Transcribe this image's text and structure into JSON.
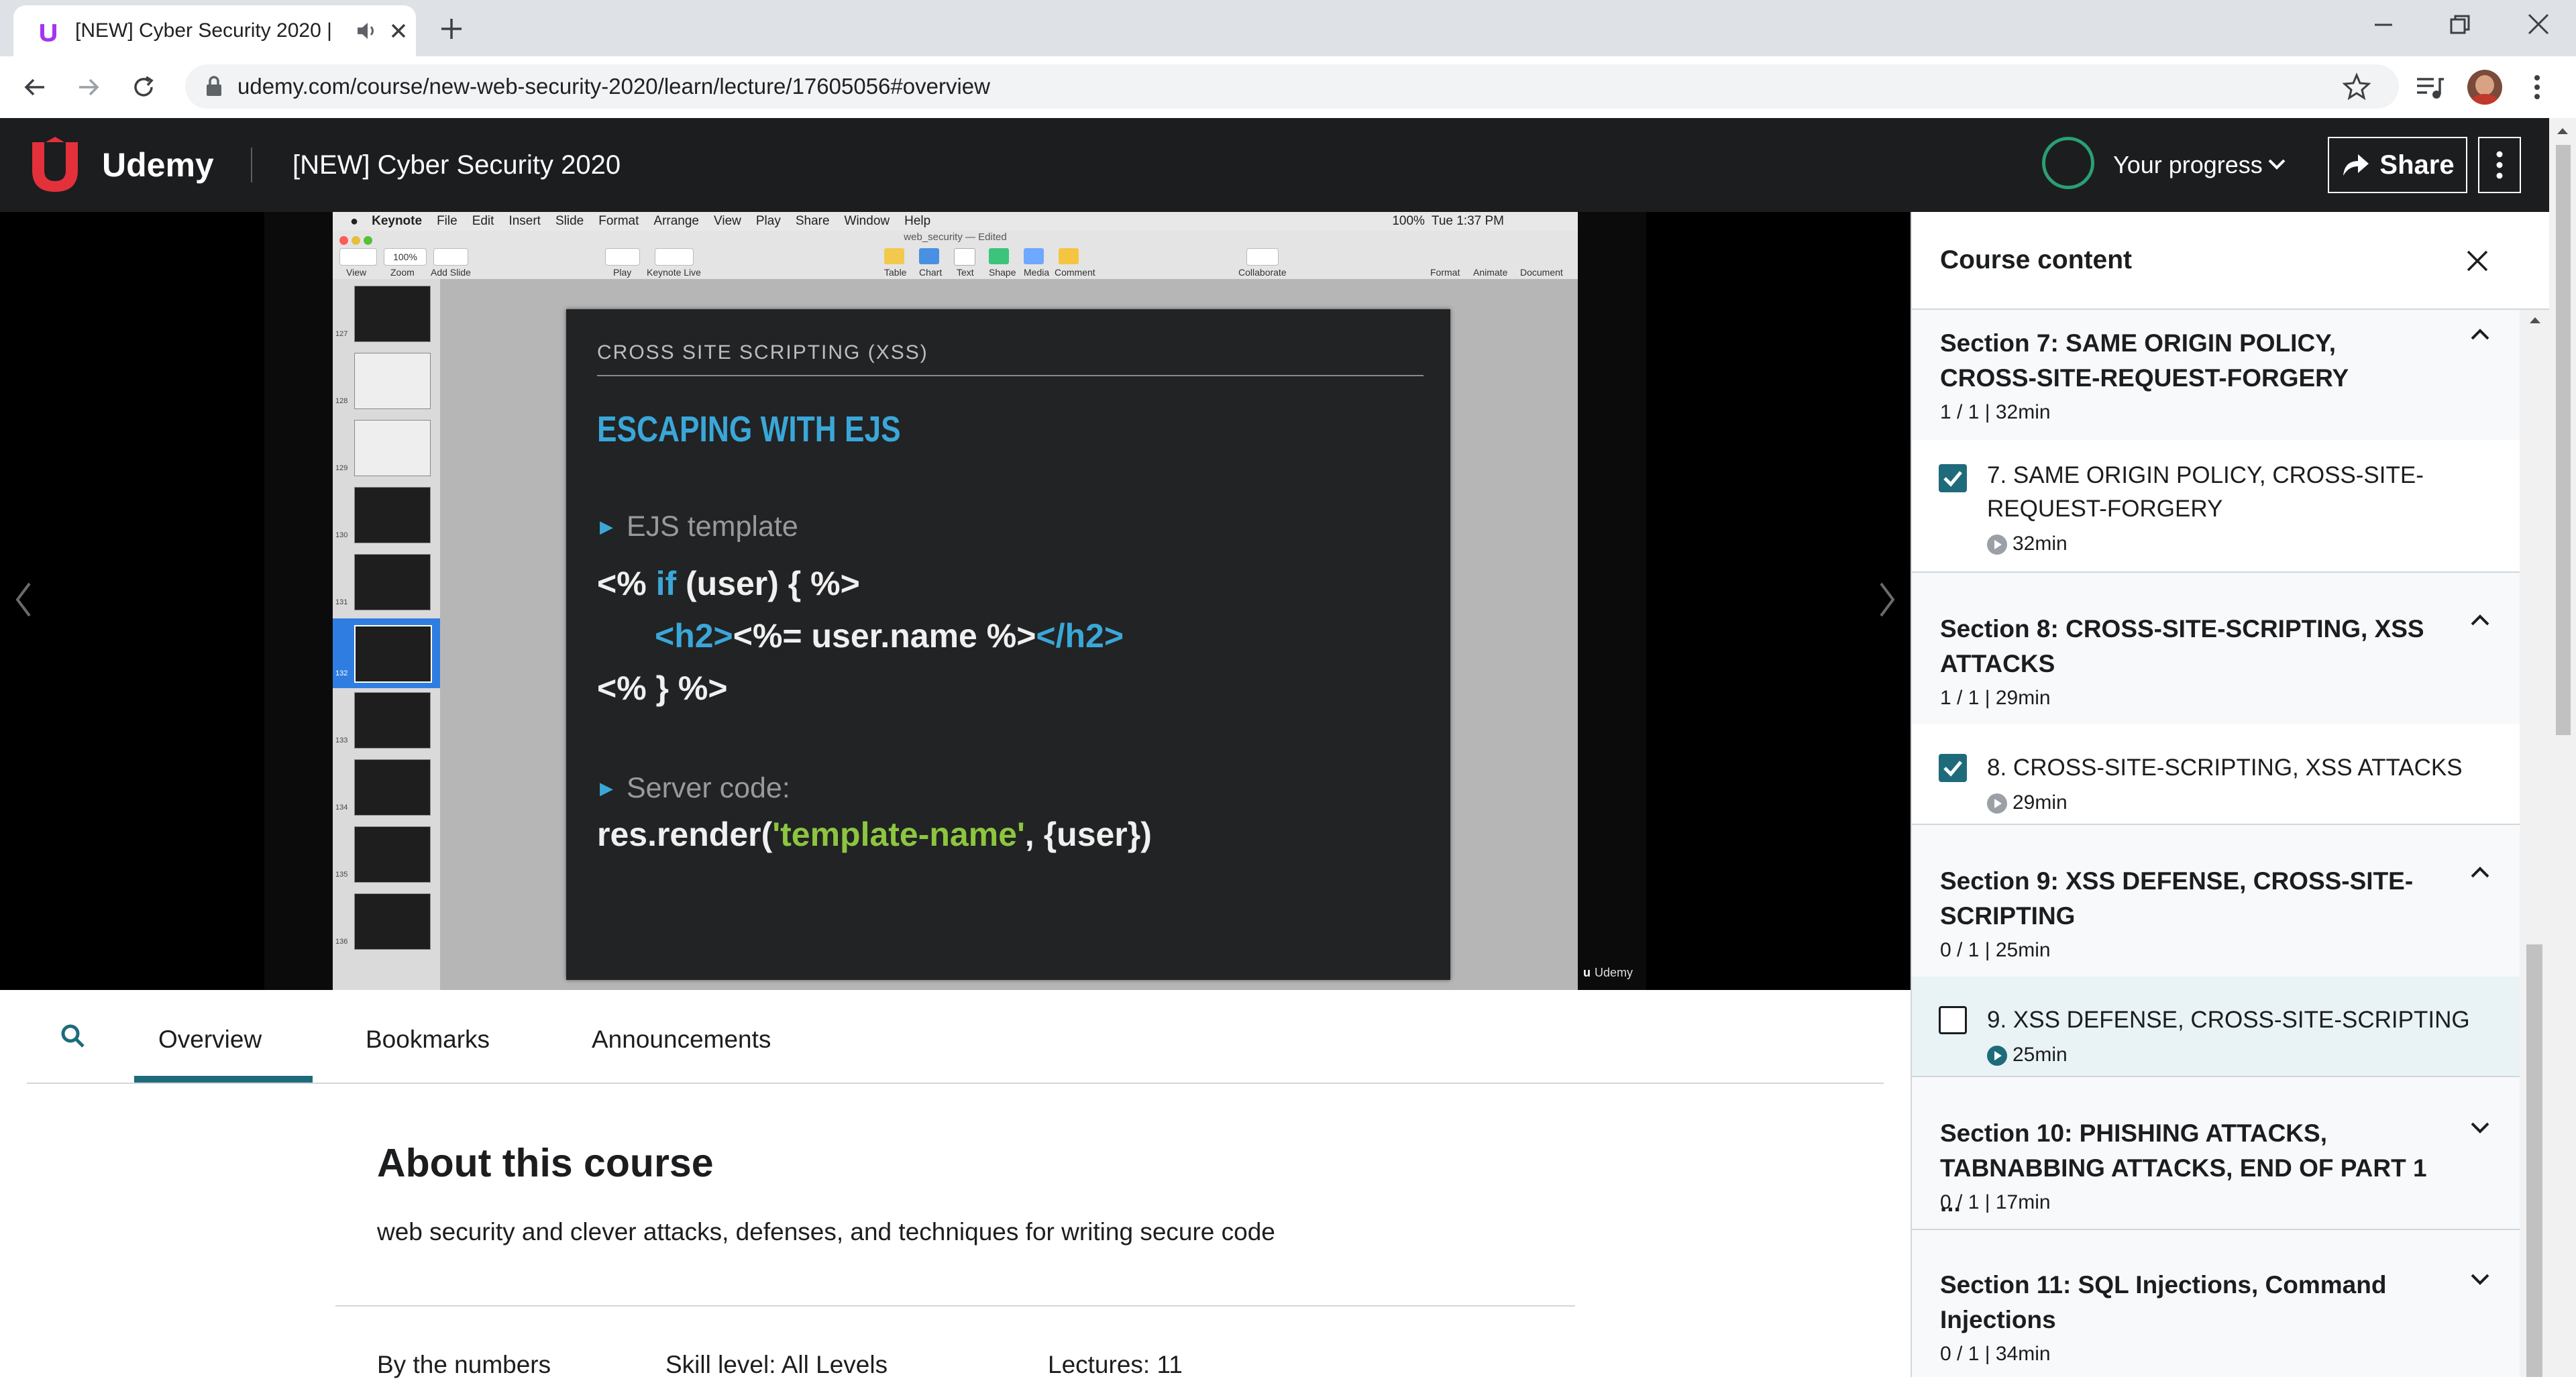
{
  "browser": {
    "tab_title": "[NEW] Cyber Security 2020 |",
    "url": "udemy.com/course/new-web-security-2020/learn/lecture/17605056#overview"
  },
  "header": {
    "brand": "Udemy",
    "course_title": "[NEW] Cyber Security 2020",
    "progress_label": "Your progress",
    "share_label": "Share"
  },
  "keynote": {
    "app_name": "Keynote",
    "menus": [
      "File",
      "Edit",
      "Insert",
      "Slide",
      "Format",
      "Arrange",
      "View",
      "Play",
      "Share",
      "Window",
      "Help"
    ],
    "status_battery": "100%",
    "status_time": "Tue 1:37 PM",
    "doc_title": "web_security — Edited",
    "zoom": "100%",
    "toolbar_left": [
      "View",
      "Zoom",
      "Add Slide"
    ],
    "toolbar_mid": [
      "Play",
      "Keynote Live"
    ],
    "toolbar_insert": [
      "Table",
      "Chart",
      "Text",
      "Shape",
      "Media",
      "Comment"
    ],
    "toolbar_collab": "Collaborate",
    "toolbar_right": [
      "Format",
      "Animate",
      "Document"
    ],
    "slide_numbers": [
      "127",
      "128",
      "129",
      "130",
      "131",
      "132",
      "133",
      "134",
      "135",
      "136"
    ],
    "watermark": "Udemy"
  },
  "slide": {
    "header": "CROSS SITE SCRIPTING (XSS)",
    "title": "ESCAPING WITH EJS",
    "bullet1": "EJS template",
    "code1_a": "<% ",
    "code1_kw": "if",
    "code1_b": " (user) { %>",
    "code2_tag1": "<h2>",
    "code2_mid": "<%= user.name %>",
    "code2_tag2": "</h2>",
    "code3": "<% } %>",
    "bullet2": "Server code:",
    "code4_a": "res.render(",
    "code4_str": "'template-name'",
    "code4_b": ", {user})"
  },
  "tabs": [
    "Overview",
    "Bookmarks",
    "Announcements"
  ],
  "overview": {
    "title": "About this course",
    "description": "web security and clever attacks, defenses, and techniques for writing secure code",
    "by_numbers": "By the numbers",
    "skill": "Skill level: All Levels",
    "lectures": "Lectures: 11"
  },
  "sidebar": {
    "title": "Course content",
    "sections": [
      {
        "title": "Section 7: SAME ORIGIN POLICY, CROSS-SITE-REQUEST-FORGERY",
        "meta": "1 / 1 | 32min",
        "lecture": {
          "title": "7. SAME ORIGIN POLICY, CROSS-SITE-REQUEST-FORGERY",
          "duration": "32min",
          "done": true
        }
      },
      {
        "title": "Section 8: CROSS-SITE-SCRIPTING, XSS ATTACKS",
        "meta": "1 / 1 | 29min",
        "lecture": {
          "title": "8. CROSS-SITE-SCRIPTING, XSS ATTACKS",
          "duration": "29min",
          "done": true
        }
      },
      {
        "title": "Section 9: XSS DEFENSE, CROSS-SITE-SCRIPTING",
        "meta": "0 / 1 | 25min",
        "lecture": {
          "title": "9. XSS DEFENSE, CROSS-SITE-SCRIPTING",
          "duration": "25min",
          "done": false
        }
      },
      {
        "title": "Section 10: PHISHING ATTACKS, TABNABBING ATTACKS, END OF PART 1 ...",
        "meta": "0 / 1 | 17min"
      },
      {
        "title": "Section 11: SQL Injections, Command Injections",
        "meta": "0 / 1 | 34min"
      }
    ]
  },
  "colors": {
    "header_bg": "#1c1d1f",
    "accent_teal": "#1e6b7b",
    "progress_green": "#2a9f73",
    "slide_title_blue": "#3aa7d8",
    "slide_string_green": "#8cc63f"
  }
}
